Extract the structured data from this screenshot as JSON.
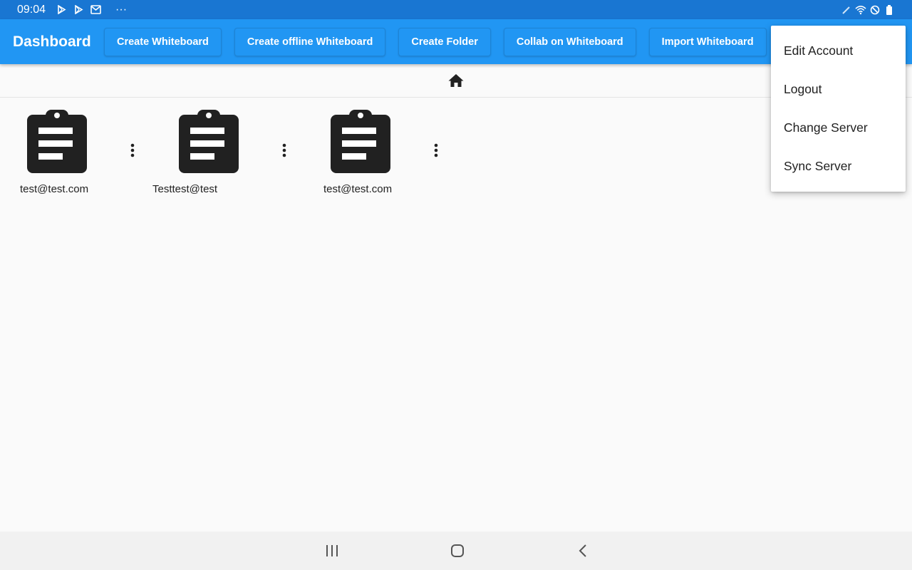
{
  "status_bar": {
    "time": "09:04",
    "more": "···",
    "left_icons": [
      "play-store-icon",
      "play-store-icon",
      "gmail-icon"
    ],
    "right_icons": [
      "pen-icon",
      "wifi-icon",
      "do-not-disturb-icon",
      "battery-icon"
    ]
  },
  "app_bar": {
    "title": "Dashboard",
    "buttons": [
      "Create Whiteboard",
      "Create offline Whiteboard",
      "Create Folder",
      "Collab on Whiteboard",
      "Import Whiteboard"
    ]
  },
  "breadcrumb": {
    "icon": "home-icon"
  },
  "items": [
    {
      "label": "test@test.com",
      "icon": "clipboard-icon"
    },
    {
      "label": "Testtest@test",
      "icon": "clipboard-icon"
    },
    {
      "label": "test@test.com",
      "icon": "clipboard-icon"
    }
  ],
  "popup_menu": {
    "items": [
      "Edit Account",
      "Logout",
      "Change Server",
      "Sync Server"
    ]
  },
  "nav_bar": {
    "icons": [
      "recent-apps-icon",
      "home-nav-icon",
      "back-icon"
    ]
  },
  "colors": {
    "status_bar": "#1976d2",
    "app_bar": "#2196f3",
    "icon": "#212121",
    "background": "#fafafa"
  }
}
